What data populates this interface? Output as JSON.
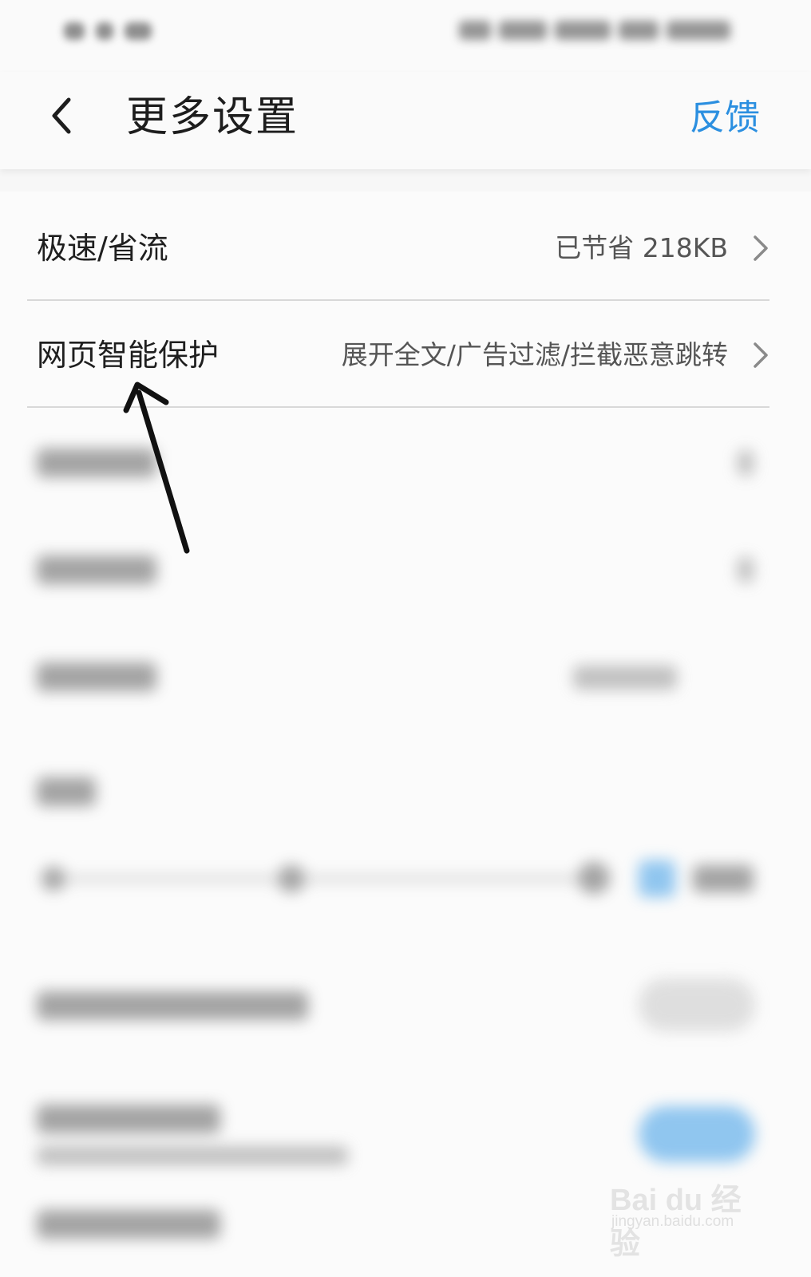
{
  "header": {
    "title": "更多设置",
    "feedback_label": "反馈",
    "back_icon": "chevron-left-icon"
  },
  "settings": [
    {
      "label": "极速/省流",
      "value": "已节省 218KB",
      "icon": "chevron-right-icon"
    },
    {
      "label": "网页智能保护",
      "value": "展开全文/广告过滤/拦截恶意跳转",
      "icon": "chevron-right-icon"
    }
  ],
  "watermark": {
    "brand": "Bai du 经验",
    "url": "jingyan.baidu.com"
  },
  "colors": {
    "accent": "#2b8fe0",
    "toggle_on": "#4aa3e8",
    "arrow": "#111111"
  }
}
